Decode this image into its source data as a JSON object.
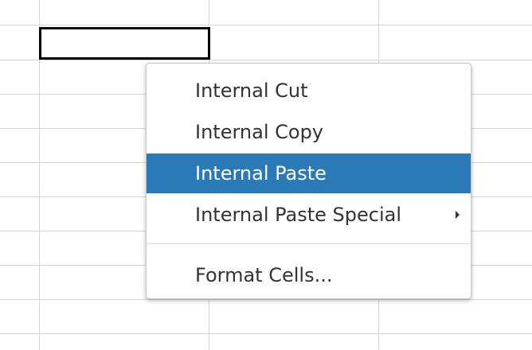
{
  "colors": {
    "accent": "#2a7ab8",
    "gridline": "#d4d4d4",
    "selection_border": "#000000"
  },
  "context_menu": {
    "items": [
      {
        "label": "Internal Cut",
        "highlighted": false,
        "has_submenu": false
      },
      {
        "label": "Internal Copy",
        "highlighted": false,
        "has_submenu": false
      },
      {
        "label": "Internal Paste",
        "highlighted": true,
        "has_submenu": false
      },
      {
        "label": "Internal Paste Special",
        "highlighted": false,
        "has_submenu": true,
        "submenu_icon": "chevron-right-icon"
      },
      {
        "label": "Format Cells...",
        "highlighted": false,
        "has_submenu": false
      }
    ]
  }
}
